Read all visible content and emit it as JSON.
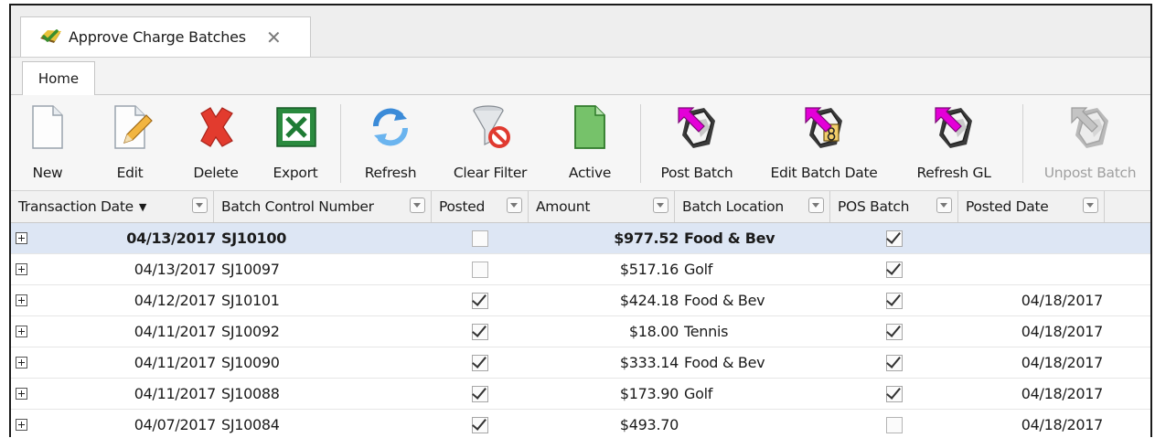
{
  "window": {
    "tab_title": "Approve Charge Batches",
    "tab_icon": "approve-checkmark-icon",
    "close_glyph": "✕"
  },
  "ribbon": {
    "tabs": [
      "Home"
    ],
    "buttons": [
      {
        "label": "New",
        "icon": "new-document-icon",
        "enabled": true
      },
      {
        "label": "Edit",
        "icon": "edit-pencil-icon",
        "enabled": true
      },
      {
        "label": "Delete",
        "icon": "delete-x-icon",
        "enabled": true
      },
      {
        "label": "Export",
        "icon": "excel-export-icon",
        "enabled": true
      },
      {
        "label": "Refresh",
        "icon": "refresh-icon",
        "enabled": true
      },
      {
        "label": "Clear Filter",
        "icon": "clear-filter-icon",
        "enabled": true
      },
      {
        "label": "Active",
        "icon": "active-document-icon",
        "enabled": true
      },
      {
        "label": "Post Batch",
        "icon": "post-batch-icon",
        "enabled": true
      },
      {
        "label": "Edit Batch Date",
        "icon": "edit-batch-date-icon",
        "enabled": true
      },
      {
        "label": "Refresh GL",
        "icon": "refresh-gl-icon",
        "enabled": true
      },
      {
        "label": "Unpost Batch",
        "icon": "unpost-batch-icon",
        "enabled": false
      }
    ]
  },
  "grid": {
    "columns": [
      {
        "label": "Transaction Date",
        "sorted": "desc"
      },
      {
        "label": "Batch Control Number"
      },
      {
        "label": "Posted"
      },
      {
        "label": "Amount"
      },
      {
        "label": "Batch Location"
      },
      {
        "label": "POS Batch"
      },
      {
        "label": "Posted Date"
      }
    ],
    "rows": [
      {
        "date": "04/13/2017",
        "batch": "SJ10100",
        "posted": false,
        "amount": "$977.52",
        "location": "Food & Bev",
        "pos": true,
        "posted_date": "",
        "selected": true
      },
      {
        "date": "04/13/2017",
        "batch": "SJ10097",
        "posted": false,
        "amount": "$517.16",
        "location": "Golf",
        "pos": true,
        "posted_date": "",
        "selected": false
      },
      {
        "date": "04/12/2017",
        "batch": "SJ10101",
        "posted": true,
        "amount": "$424.18",
        "location": "Food & Bev",
        "pos": true,
        "posted_date": "04/18/2017",
        "selected": false
      },
      {
        "date": "04/11/2017",
        "batch": "SJ10092",
        "posted": true,
        "amount": "$18.00",
        "location": "Tennis",
        "pos": true,
        "posted_date": "04/18/2017",
        "selected": false
      },
      {
        "date": "04/11/2017",
        "batch": "SJ10090",
        "posted": true,
        "amount": "$333.14",
        "location": "Food & Bev",
        "pos": true,
        "posted_date": "04/18/2017",
        "selected": false
      },
      {
        "date": "04/11/2017",
        "batch": "SJ10088",
        "posted": true,
        "amount": "$173.90",
        "location": "Golf",
        "pos": true,
        "posted_date": "04/18/2017",
        "selected": false
      },
      {
        "date": "04/07/2017",
        "batch": "SJ10084",
        "posted": true,
        "amount": "$493.70",
        "location": "",
        "pos": false,
        "posted_date": "04/18/2017",
        "selected": false
      }
    ]
  },
  "colors": {
    "selected_row": "#dde6f4",
    "delete_red": "#e23b2e",
    "excel_green": "#1e7b34",
    "post_magenta": "#e400d8"
  }
}
